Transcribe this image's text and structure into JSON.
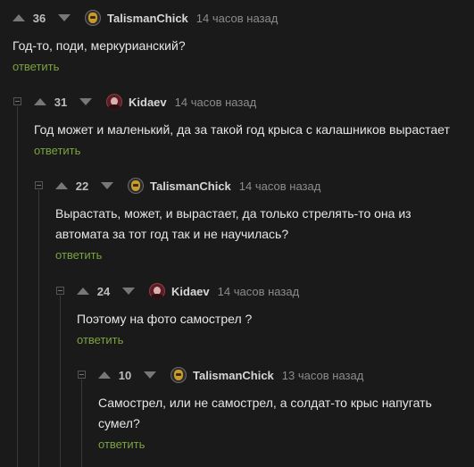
{
  "reply_label": "ответить",
  "colors": {
    "background": "#1a1a1a",
    "reply_link": "#7aa33e",
    "time": "#8c8c8c"
  },
  "comments": [
    {
      "score": "36",
      "author": "TalismanChick",
      "avatar_icon": "talismanchick-avatar",
      "time": "14 часов назад",
      "text": "Год-то, поди, меркурианский?"
    },
    {
      "score": "31",
      "author": "Kidaev",
      "avatar_icon": "kidaev-avatar",
      "time": "14 часов назад",
      "text": "Год может и маленький, да за такой год крыса с калашников вырастает"
    },
    {
      "score": "22",
      "author": "TalismanChick",
      "avatar_icon": "talismanchick-avatar",
      "time": "14 часов назад",
      "text": "Вырастать, может, и вырастает, да только стрелять-то она из автомата за тот год так и не научилась?"
    },
    {
      "score": "24",
      "author": "Kidaev",
      "avatar_icon": "kidaev-avatar",
      "time": "14 часов назад",
      "text": "Поэтому на фото самострел ?"
    },
    {
      "score": "10",
      "author": "TalismanChick",
      "avatar_icon": "talismanchick-avatar",
      "time": "13 часов назад",
      "text": "Самострел, или не самострел, а солдат-то крыс напугать сумел?"
    }
  ]
}
